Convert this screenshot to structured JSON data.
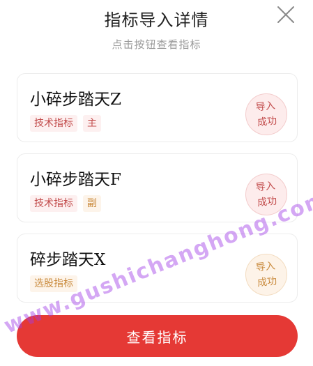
{
  "header": {
    "title": "指标导入详情",
    "subtitle": "点击按钮查看指标"
  },
  "cards": [
    {
      "name": "小碎步踏天Z",
      "tags": [
        {
          "label": "技术指标",
          "tone": "red"
        },
        {
          "label": "主",
          "tone": "red"
        }
      ],
      "status": {
        "line1": "导入",
        "line2": "成功",
        "tone": "red"
      }
    },
    {
      "name": "小碎步踏天F",
      "tags": [
        {
          "label": "技术指标",
          "tone": "red"
        },
        {
          "label": "副",
          "tone": "orange"
        }
      ],
      "status": {
        "line1": "导入",
        "line2": "成功",
        "tone": "red"
      }
    },
    {
      "name": "碎步踏天X",
      "tags": [
        {
          "label": "选股指标",
          "tone": "orange"
        }
      ],
      "status": {
        "line1": "导入",
        "line2": "成功",
        "tone": "orange"
      }
    }
  ],
  "footer": {
    "view_button_label": "查看指标"
  },
  "watermark": "www.gushichanghong.com",
  "colors": {
    "primary_red": "#e53935",
    "tag_red": "#c24b4b",
    "tag_orange": "#c98a3c"
  },
  "icons": {
    "close": "close-icon"
  }
}
